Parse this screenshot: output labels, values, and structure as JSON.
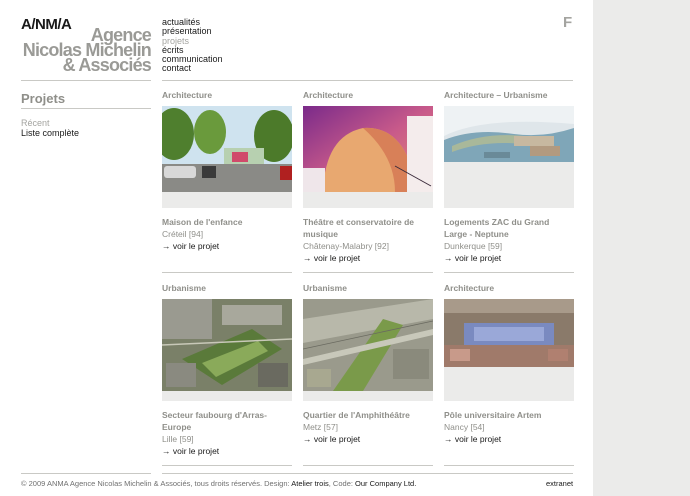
{
  "header": {
    "logo_short": "A/NM/A",
    "logo_name_lines": [
      "Agence",
      "Nicolas Michelin",
      "& Associés"
    ],
    "language_switch": "F",
    "nav": [
      {
        "label": "actualités",
        "active": false
      },
      {
        "label": "présentation",
        "active": false
      },
      {
        "label": "projets",
        "active": true
      },
      {
        "label": "écrits",
        "active": false
      },
      {
        "label": "communication",
        "active": false
      },
      {
        "label": "contact",
        "active": false
      }
    ]
  },
  "sidebar": {
    "title": "Projets",
    "items": [
      {
        "label": "Récent",
        "active": true
      },
      {
        "label": "Liste complète",
        "active": false
      }
    ]
  },
  "projects": [
    {
      "category": "Architecture",
      "title": "Maison de l'enfance",
      "location": "Créteil [94]",
      "link": "→ voir le projet",
      "image": "park-photo"
    },
    {
      "category": "Architecture",
      "title": "Théâtre et conservatoire de musique",
      "location": "Châtenay-Malabry [92]",
      "link": "→ voir le projet",
      "image": "theatre-photo"
    },
    {
      "category": "Architecture – Urbanisme",
      "title": "Logements ZAC du Grand Large - Neptune",
      "location": "Dunkerque [59]",
      "link": "→ voir le projet",
      "image": "harbor-aerial-photo"
    },
    {
      "category": "Urbanisme",
      "title": "Secteur faubourg d'Arras-Europe",
      "location": "Lille [59]",
      "link": "→ voir le projet",
      "image": "city-aerial-photo"
    },
    {
      "category": "Urbanisme",
      "title": "Quartier de l'Amphithéâtre",
      "location": "Metz [57]",
      "link": "→ voir le projet",
      "image": "rail-aerial-photo"
    },
    {
      "category": "Architecture",
      "title": "Pôle universitaire Artem",
      "location": "Nancy [54]",
      "link": "→ voir le projet",
      "image": "campus-aerial-photo"
    }
  ],
  "footer": {
    "copyright": "© 2009 ANMA Agence Nicolas Michelin & Associés, tous droits réservés. Design: ",
    "design_link": "Atelier trois",
    "code_text": ", Code: ",
    "code_link": "Our Company Ltd.",
    "extranet": "extranet"
  },
  "colors": {
    "gray_text": "#8f8f8a",
    "light_gray": "#a4a4a0",
    "panel": "#ebebea",
    "rule": "#c9c9c5"
  }
}
